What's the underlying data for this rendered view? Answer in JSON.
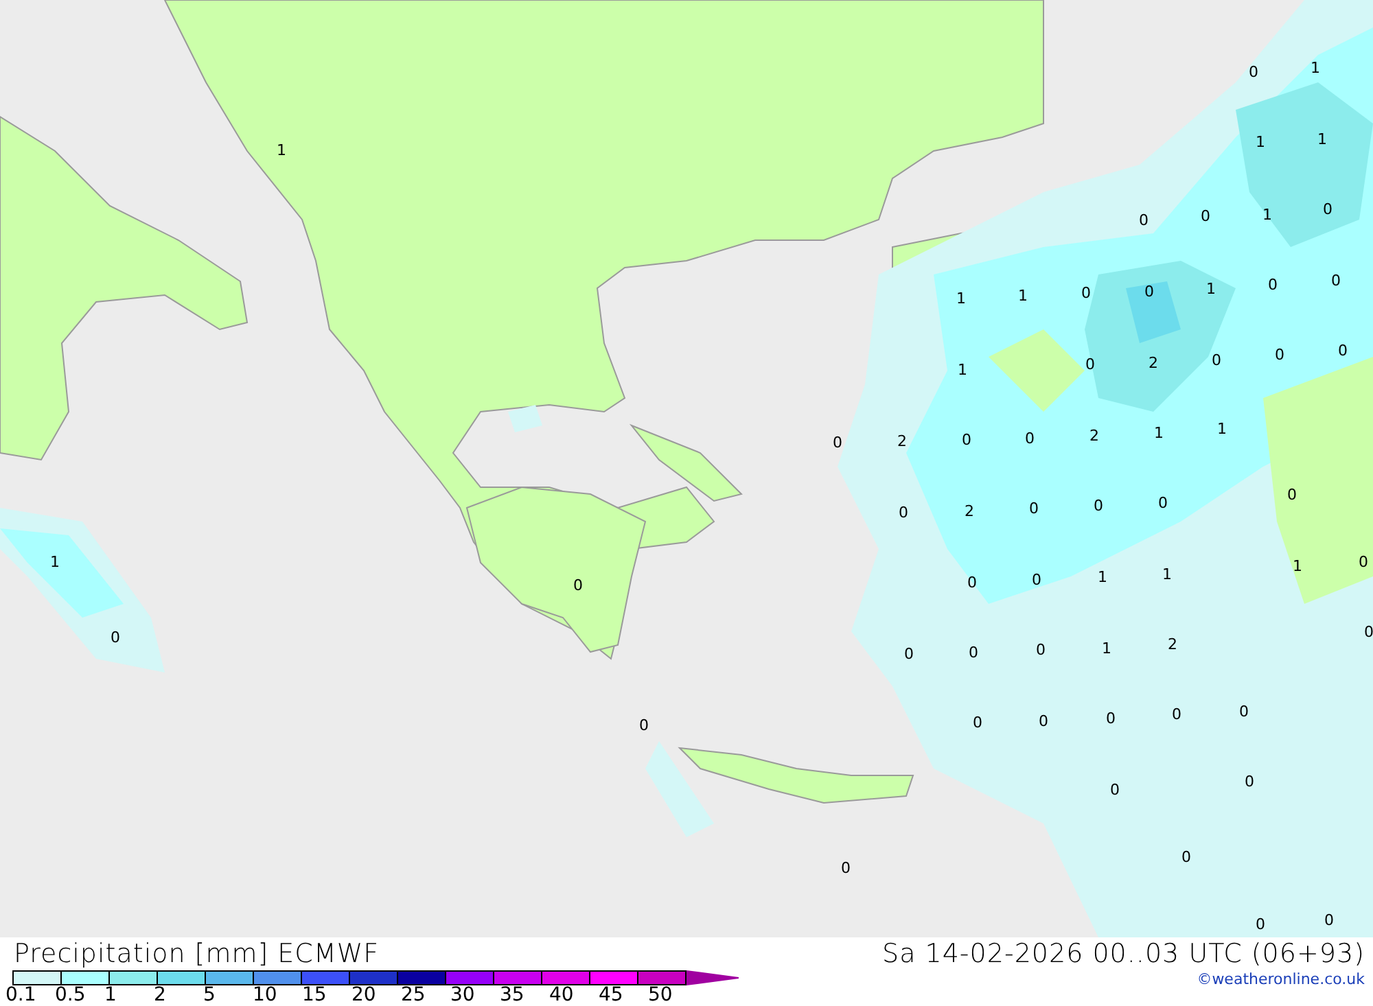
{
  "map": {
    "value_labels": [
      {
        "text": "1"
      },
      {
        "text": "0"
      },
      {
        "text": "1"
      },
      {
        "text": "1"
      },
      {
        "text": "1"
      },
      {
        "text": "0"
      },
      {
        "text": "0"
      },
      {
        "text": "1"
      },
      {
        "text": "0"
      },
      {
        "text": "1"
      },
      {
        "text": "1"
      },
      {
        "text": "0"
      },
      {
        "text": "0"
      },
      {
        "text": "1"
      },
      {
        "text": "0"
      },
      {
        "text": "0"
      },
      {
        "text": "1"
      },
      {
        "text": "0"
      },
      {
        "text": "2"
      },
      {
        "text": "0"
      },
      {
        "text": "0"
      },
      {
        "text": "0"
      },
      {
        "text": "0"
      },
      {
        "text": "2"
      },
      {
        "text": "0"
      },
      {
        "text": "0"
      },
      {
        "text": "2"
      },
      {
        "text": "1"
      },
      {
        "text": "1"
      },
      {
        "text": "0"
      },
      {
        "text": "0"
      },
      {
        "text": "2"
      },
      {
        "text": "0"
      },
      {
        "text": "0"
      },
      {
        "text": "0"
      },
      {
        "text": "1"
      },
      {
        "text": "1"
      },
      {
        "text": "0"
      },
      {
        "text": "0"
      },
      {
        "text": "0"
      },
      {
        "text": "0"
      },
      {
        "text": "1"
      },
      {
        "text": "1"
      },
      {
        "text": "0"
      },
      {
        "text": "0"
      },
      {
        "text": "0"
      },
      {
        "text": "0"
      },
      {
        "text": "0"
      },
      {
        "text": "1"
      },
      {
        "text": "2"
      },
      {
        "text": "0"
      },
      {
        "text": "0"
      },
      {
        "text": "0"
      },
      {
        "text": "0"
      },
      {
        "text": "0"
      },
      {
        "text": "0"
      },
      {
        "text": "0"
      },
      {
        "text": "0"
      },
      {
        "text": "0"
      },
      {
        "text": "0"
      },
      {
        "text": "0"
      },
      {
        "text": "0"
      }
    ]
  },
  "footer": {
    "title": "Precipitation [mm] ECMWF",
    "valid_time": "Sa 14-02-2026 00..03 UTC (06+93)",
    "credit": "©weatheronline.co.uk"
  },
  "legend": {
    "bins": [
      {
        "color": "#d4f7f7"
      },
      {
        "color": "#aaffff"
      },
      {
        "color": "#8cecec"
      },
      {
        "color": "#6cdcec"
      },
      {
        "color": "#5ab8ec"
      },
      {
        "color": "#5090ec"
      },
      {
        "color": "#3c50f8"
      },
      {
        "color": "#1e30c8"
      },
      {
        "color": "#0a00a0"
      },
      {
        "color": "#9600f8"
      },
      {
        "color": "#c800f0"
      },
      {
        "color": "#e000e8"
      },
      {
        "color": "#ff00ff"
      },
      {
        "color": "#c800c0"
      }
    ],
    "overflow": {
      "color": "#a000a0"
    },
    "ticks": [
      "0.1",
      "0.5",
      "1",
      "2",
      "5",
      "10",
      "15",
      "20",
      "25",
      "30",
      "35",
      "40",
      "45",
      "50"
    ]
  }
}
